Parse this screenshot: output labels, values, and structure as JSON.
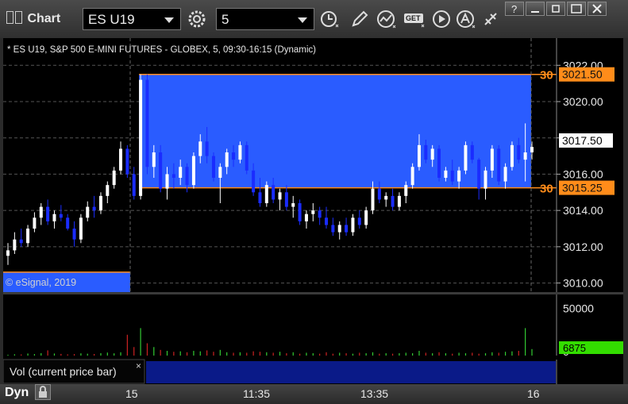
{
  "window": {
    "title": "Chart"
  },
  "toolbar": {
    "symbol": "ES U19",
    "interval": "5",
    "get_label": "GET"
  },
  "chart": {
    "header": "* ES U19, S&P 500 E-MINI FUTURES - GLOBEX, 5, 09:30-16:15 (Dynamic)",
    "watermark": "© eSignal, 2019",
    "price_ticks": [
      "3022.00",
      "3020.00",
      "3018.00",
      "3016.00",
      "3014.00",
      "3012.00",
      "3010.00"
    ],
    "price_tick_values": [
      3022,
      3020,
      3018,
      3016,
      3014,
      3012,
      3010
    ],
    "price_range": [
      3009.5,
      3023.5
    ],
    "last_price": "3017.50",
    "range_high": {
      "label": "3021.50",
      "value": 3021.5,
      "tag": "30"
    },
    "range_low": {
      "label": "3015.25",
      "value": 3015.25,
      "tag": "30"
    },
    "prior_range_value": 3010.6
  },
  "volume": {
    "pane_label": "Vol (current price bar)",
    "ticks": [
      "50000",
      "0"
    ],
    "tick_values": [
      50000,
      0
    ],
    "range": [
      0,
      62000
    ],
    "current": "6875",
    "current_value": 6875
  },
  "xaxis": {
    "ticks": [
      "15",
      "11:35",
      "13:35",
      "16"
    ]
  },
  "bottom": {
    "mode": "Dyn"
  },
  "colors": {
    "range_box": "#2a5cff",
    "range_line": "#ff8c1a",
    "up_bar": "#ffffff",
    "down_bar": "#1a2cff",
    "vol_up": "#33cc33",
    "vol_down": "#cc2222",
    "current_vol_badge": "#33dd00"
  },
  "chart_data": {
    "type": "bar",
    "price_ohlc": [
      [
        3011.5,
        3012.2,
        3011.0,
        3011.8
      ],
      [
        3011.8,
        3012.8,
        3011.6,
        3012.4
      ],
      [
        3012.4,
        3013.0,
        3012.0,
        3012.2
      ],
      [
        3012.2,
        3013.2,
        3012.0,
        3013.0
      ],
      [
        3013.0,
        3013.9,
        3012.8,
        3013.6
      ],
      [
        3013.6,
        3014.4,
        3013.2,
        3014.2
      ],
      [
        3014.2,
        3014.6,
        3013.2,
        3013.4
      ],
      [
        3013.4,
        3014.0,
        3013.0,
        3013.8
      ],
      [
        3013.8,
        3014.3,
        3013.4,
        3013.6
      ],
      [
        3013.6,
        3013.8,
        3012.9,
        3013.0
      ],
      [
        3013.0,
        3013.4,
        3012.0,
        3012.4
      ],
      [
        3012.4,
        3013.8,
        3012.2,
        3013.6
      ],
      [
        3013.6,
        3014.5,
        3013.4,
        3014.2
      ],
      [
        3014.2,
        3014.8,
        3013.6,
        3014.0
      ],
      [
        3014.0,
        3015.0,
        3013.8,
        3014.8
      ],
      [
        3014.8,
        3015.6,
        3014.4,
        3015.4
      ],
      [
        3015.4,
        3016.4,
        3015.2,
        3016.2
      ],
      [
        3016.2,
        3017.8,
        3016.0,
        3017.4
      ],
      [
        3017.4,
        3017.6,
        3015.8,
        3016.0
      ],
      [
        3016.0,
        3016.4,
        3014.6,
        3014.8
      ],
      [
        3014.8,
        3021.5,
        3014.6,
        3021.2
      ],
      [
        3021.2,
        3021.5,
        3016.0,
        3016.4
      ],
      [
        3016.4,
        3017.6,
        3015.8,
        3017.2
      ],
      [
        3017.2,
        3017.6,
        3015.0,
        3015.2
      ],
      [
        3015.2,
        3016.4,
        3014.6,
        3016.0
      ],
      [
        3016.0,
        3016.6,
        3015.2,
        3015.8
      ],
      [
        3015.8,
        3016.8,
        3015.4,
        3016.4
      ],
      [
        3016.4,
        3016.6,
        3015.0,
        3015.4
      ],
      [
        3015.4,
        3017.2,
        3015.2,
        3017.0
      ],
      [
        3017.0,
        3018.2,
        3016.6,
        3017.8
      ],
      [
        3017.8,
        3018.6,
        3016.6,
        3017.0
      ],
      [
        3017.0,
        3017.2,
        3015.6,
        3015.8
      ],
      [
        3015.8,
        3016.6,
        3014.4,
        3016.4
      ],
      [
        3016.4,
        3017.4,
        3016.0,
        3017.2
      ],
      [
        3017.2,
        3017.6,
        3016.4,
        3016.8
      ],
      [
        3016.8,
        3017.8,
        3016.6,
        3017.6
      ],
      [
        3017.6,
        3017.8,
        3016.0,
        3016.2
      ],
      [
        3016.2,
        3016.6,
        3014.8,
        3015.0
      ],
      [
        3015.0,
        3015.8,
        3014.2,
        3014.4
      ],
      [
        3014.4,
        3015.6,
        3014.2,
        3015.4
      ],
      [
        3015.4,
        3015.8,
        3014.4,
        3014.6
      ],
      [
        3014.6,
        3015.2,
        3014.0,
        3015.0
      ],
      [
        3015.0,
        3015.4,
        3014.0,
        3014.2
      ],
      [
        3014.2,
        3014.8,
        3013.6,
        3014.4
      ],
      [
        3014.4,
        3014.6,
        3013.2,
        3013.4
      ],
      [
        3013.4,
        3014.0,
        3013.0,
        3013.8
      ],
      [
        3013.8,
        3014.4,
        3013.4,
        3014.0
      ],
      [
        3014.0,
        3014.2,
        3013.2,
        3013.6
      ],
      [
        3013.6,
        3014.2,
        3013.0,
        3013.2
      ],
      [
        3013.2,
        3013.6,
        3012.6,
        3012.8
      ],
      [
        3012.8,
        3013.4,
        3012.4,
        3013.2
      ],
      [
        3013.2,
        3013.6,
        3012.6,
        3012.8
      ],
      [
        3012.8,
        3013.8,
        3012.6,
        3013.6
      ],
      [
        3013.6,
        3014.0,
        3013.0,
        3013.2
      ],
      [
        3013.2,
        3014.2,
        3013.0,
        3014.0
      ],
      [
        3014.0,
        3015.6,
        3013.8,
        3015.2
      ],
      [
        3015.2,
        3015.6,
        3014.4,
        3014.6
      ],
      [
        3014.6,
        3015.0,
        3014.2,
        3014.8
      ],
      [
        3014.8,
        3015.2,
        3014.0,
        3014.2
      ],
      [
        3014.2,
        3015.0,
        3014.0,
        3014.8
      ],
      [
        3014.8,
        3015.6,
        3014.4,
        3015.4
      ],
      [
        3015.4,
        3016.6,
        3015.2,
        3016.4
      ],
      [
        3016.4,
        3018.2,
        3016.2,
        3017.6
      ],
      [
        3017.6,
        3017.9,
        3016.6,
        3016.8
      ],
      [
        3016.8,
        3017.6,
        3016.4,
        3017.4
      ],
      [
        3017.4,
        3017.6,
        3015.6,
        3015.8
      ],
      [
        3015.8,
        3016.4,
        3015.6,
        3016.2
      ],
      [
        3016.2,
        3016.8,
        3015.4,
        3015.6
      ],
      [
        3015.6,
        3016.4,
        3015.2,
        3016.2
      ],
      [
        3016.2,
        3017.8,
        3016.0,
        3017.6
      ],
      [
        3017.6,
        3017.8,
        3016.6,
        3016.8
      ],
      [
        3016.8,
        3016.9,
        3014.6,
        3015.2
      ],
      [
        3015.2,
        3016.4,
        3014.6,
        3016.2
      ],
      [
        3016.2,
        3017.6,
        3015.8,
        3017.4
      ],
      [
        3017.4,
        3017.6,
        3015.4,
        3015.6
      ],
      [
        3015.6,
        3016.6,
        3015.2,
        3016.4
      ],
      [
        3016.4,
        3017.8,
        3016.2,
        3017.6
      ],
      [
        3017.6,
        3018.0,
        3016.6,
        3016.8
      ],
      [
        3016.8,
        3018.8,
        3015.6,
        3017.2
      ],
      [
        3017.2,
        3017.8,
        3016.8,
        3017.5
      ]
    ],
    "volume": [
      900,
      1400,
      1200,
      2200,
      1600,
      2600,
      5500,
      2200,
      1800,
      1300,
      1600,
      2400,
      2000,
      1700,
      2600,
      3200,
      2400,
      3500,
      22000,
      9000,
      29000,
      13000,
      9000,
      6000,
      5000,
      4000,
      4500,
      3500,
      5000,
      4500,
      5500,
      4000,
      6000,
      3500,
      3000,
      3500,
      3000,
      4500,
      4000,
      3500,
      3000,
      4000,
      2500,
      3500,
      2000,
      3000,
      2500,
      2000,
      3500,
      2000,
      3000,
      2500,
      2000,
      3000,
      2500,
      3500,
      2000,
      2500,
      2000,
      2500,
      3000,
      2500,
      5000,
      3000,
      2500,
      3500,
      2500,
      2000,
      3000,
      2500,
      3000,
      2000,
      2500,
      3500,
      3000,
      4000,
      4500,
      5000,
      29000,
      6875
    ]
  }
}
